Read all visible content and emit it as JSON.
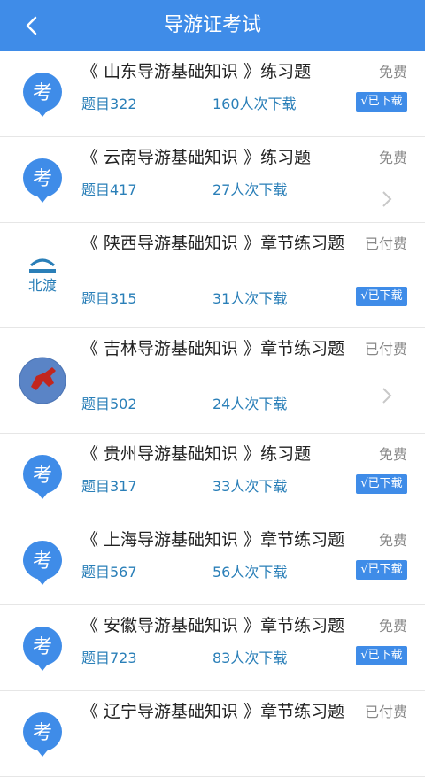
{
  "header": {
    "title": "导游证考试"
  },
  "items": [
    {
      "name": "《 山东导游基础知识 》练习题",
      "questions": "题目322",
      "downloads": "160人次下载",
      "price": "免费",
      "status": "√已下载",
      "icon": "kao-icon"
    },
    {
      "name": "《 云南导游基础知识 》练习题",
      "questions": "题目417",
      "downloads": "27人次下载",
      "price": "免费",
      "status": "",
      "icon": "kao-icon"
    },
    {
      "name": "《 陕西导游基础知识 》章节练习题",
      "questions": "题目315",
      "downloads": "31人次下载",
      "price": "已付费",
      "status": "√已下载",
      "icon": "beidu-logo-icon"
    },
    {
      "name": "《 吉林导游基础知识 》章节练习题",
      "questions": "题目502",
      "downloads": "24人次下载",
      "price": "已付费",
      "status": "",
      "icon": "horse-logo-icon"
    },
    {
      "name": "《 贵州导游基础知识 》练习题",
      "questions": "题目317",
      "downloads": "33人次下载",
      "price": "免费",
      "status": "√已下载",
      "icon": "kao-icon"
    },
    {
      "name": "《 上海导游基础知识 》章节练习题",
      "questions": "题目567",
      "downloads": "56人次下载",
      "price": "免费",
      "status": "√已下载",
      "icon": "kao-icon"
    },
    {
      "name": "《 安徽导游基础知识 》章节练习题",
      "questions": "题目723",
      "downloads": "83人次下载",
      "price": "免费",
      "status": "√已下载",
      "icon": "kao-icon"
    },
    {
      "name": "《 辽宁导游基础知识 》章节练习题",
      "questions": "",
      "downloads": "",
      "price": "已付费",
      "status": "",
      "icon": "kao-icon"
    }
  ],
  "icon_glyph": "考",
  "colors": {
    "accent": "#3f8ce8",
    "link": "#2a7fb8"
  }
}
